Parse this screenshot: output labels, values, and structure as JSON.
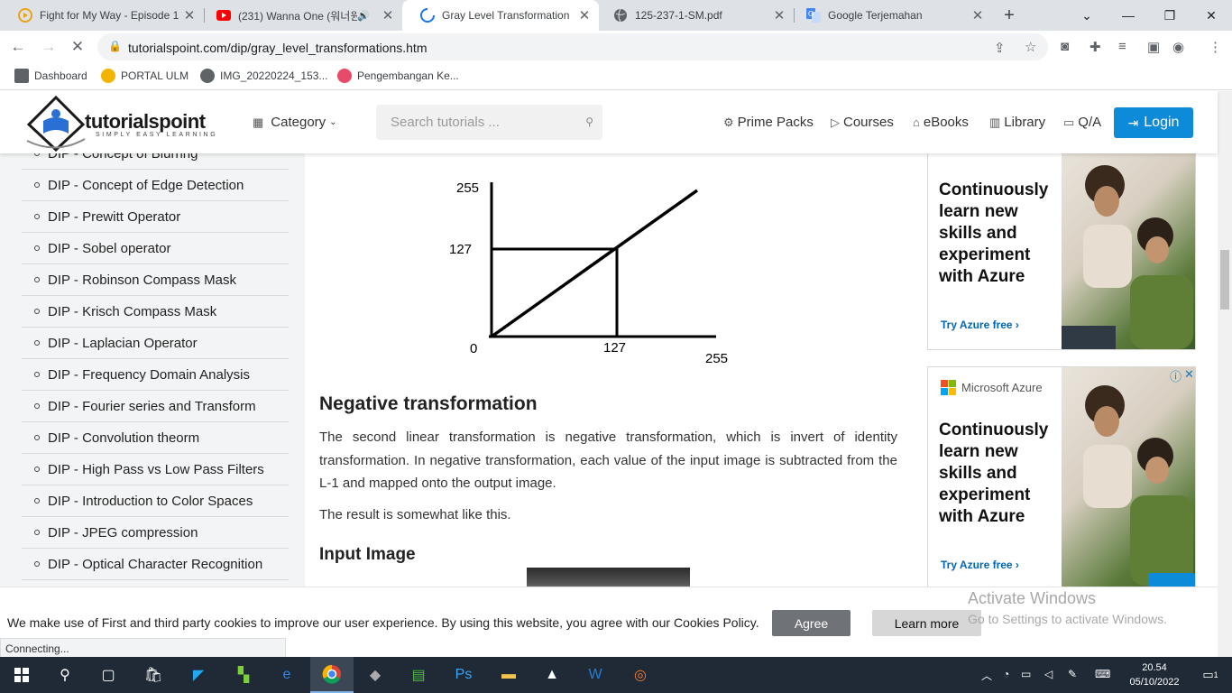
{
  "browser": {
    "tabs": [
      {
        "title": "Fight for My Way - Episode 1",
        "icon": "play-circle-icon"
      },
      {
        "title": "(231) Wanna One (워너원",
        "icon": "youtube-icon"
      },
      {
        "title": "Gray Level Transformation",
        "icon": "loading-spinner-icon"
      },
      {
        "title": "125-237-1-SM.pdf",
        "icon": "globe-icon"
      },
      {
        "title": "Google Terjemahan",
        "icon": "google-translate-icon"
      }
    ],
    "url": "tutorialspoint.com/dip/gray_level_transformations.htm",
    "bookmarks": [
      {
        "label": "Dashboard"
      },
      {
        "label": "PORTAL ULM"
      },
      {
        "label": "IMG_20220224_153..."
      },
      {
        "label": "Pengembangan Ke..."
      }
    ]
  },
  "header": {
    "brand": "tutorialspoint",
    "tagline": "SIMPLY EASY LEARNING",
    "category": "Category",
    "search_placeholder": "Search tutorials ...",
    "nav": [
      "Prime Packs",
      "Courses",
      "eBooks",
      "Library",
      "Q/A"
    ],
    "login": "Login"
  },
  "sidebar": {
    "items": [
      "DIP - Concept of Blurring",
      "DIP - Concept of Edge Detection",
      "DIP - Prewitt Operator",
      "DIP - Sobel operator",
      "DIP - Robinson Compass Mask",
      "DIP - Krisch Compass Mask",
      "DIP - Laplacian Operator",
      "DIP - Frequency Domain Analysis",
      "DIP - Fourier series and Transform",
      "DIP - Convolution theorm",
      "DIP - High Pass vs Low Pass Filters",
      "DIP - Introduction to Color Spaces",
      "DIP - JPEG compression",
      "DIP - Optical Character Recognition"
    ]
  },
  "content": {
    "graph": {
      "y_top": "255",
      "y_mid": "127",
      "origin": "0",
      "x_mid": "127",
      "x_end": "255"
    },
    "heading_negative": "Negative transformation",
    "paragraph1": "The second linear transformation is negative transformation, which is invert of identity transformation. In negative transformation, each value of the input image is subtracted from the L-1 and mapped onto the output image.",
    "paragraph2": "The result is somewhat like this.",
    "heading_input": "Input Image"
  },
  "ads": [
    {
      "brand": "",
      "text": "Continuously learn new skills and experiment with Azure",
      "cta": "Try Azure free ›"
    },
    {
      "brand": "Microsoft Azure",
      "text": "Continuously learn new skills and experiment with Azure",
      "cta": "Try Azure free ›"
    }
  ],
  "cookie": {
    "message": "We make use of First and third party cookies to improve our user experience. By using this website, you agree with our Cookies Policy.",
    "agree": "Agree",
    "learn_more": "Learn more"
  },
  "status_text": "Connecting...",
  "watermark": {
    "line1": "Activate Windows",
    "line2": "Go to Settings to activate Windows."
  },
  "taskbar": {
    "time": "20.54",
    "date": "05/10/2022",
    "notifications": "1"
  }
}
